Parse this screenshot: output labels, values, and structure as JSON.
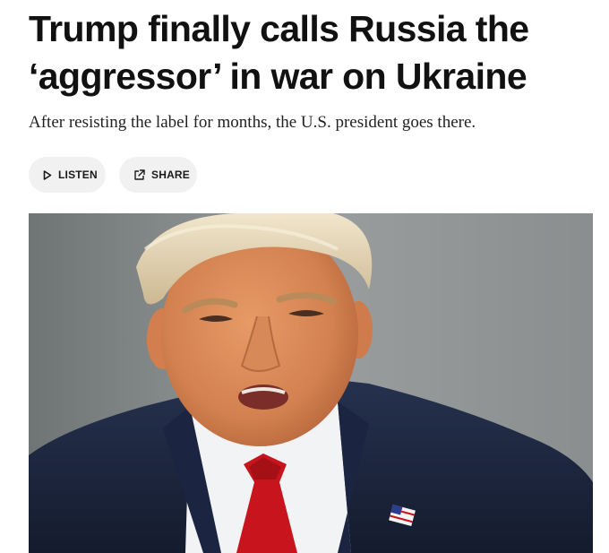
{
  "article": {
    "headline": "Trump finally calls Russia the ‘aggressor’ in war on Ukraine",
    "dek": "After resisting the label for months, the U.S. president goes there."
  },
  "actions": {
    "listen_label": "LISTEN",
    "listen_icon": "play-icon",
    "share_label": "SHARE",
    "share_icon": "share-external-icon"
  },
  "hero_image": {
    "description_tag": "portrait-photo",
    "colors": {
      "background": "#8f9394",
      "suit": "#1f2a44",
      "tie": "#c8141c",
      "skin": "#d98a5a",
      "hair": "#e6d7b8"
    }
  }
}
